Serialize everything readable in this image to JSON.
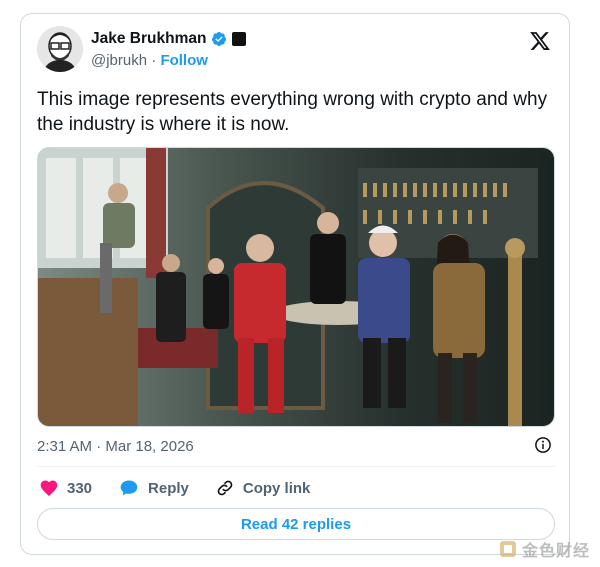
{
  "author": {
    "name": "Jake Brukhman",
    "handle": "@jbrukh",
    "separator": "·",
    "follow_label": "Follow"
  },
  "tweet": {
    "text": "This image represents everything wrong with crypto and why the industry is where it is now.",
    "timestamp": "2:31 AM · Mar 18, 2026"
  },
  "actions": {
    "like_count": "330",
    "reply_label": "Reply",
    "copy_label": "Copy link"
  },
  "read_replies_label": "Read 42 replies",
  "watermark": "金色财经",
  "colors": {
    "accent": "#1d9bf0",
    "like": "#f91880",
    "muted": "#536471",
    "border": "#cfd9de"
  },
  "icons": [
    "verified-badge-icon",
    "x-logo-icon",
    "info-icon",
    "heart-icon",
    "reply-bubble-icon",
    "link-icon",
    "watermark-logo-icon"
  ]
}
